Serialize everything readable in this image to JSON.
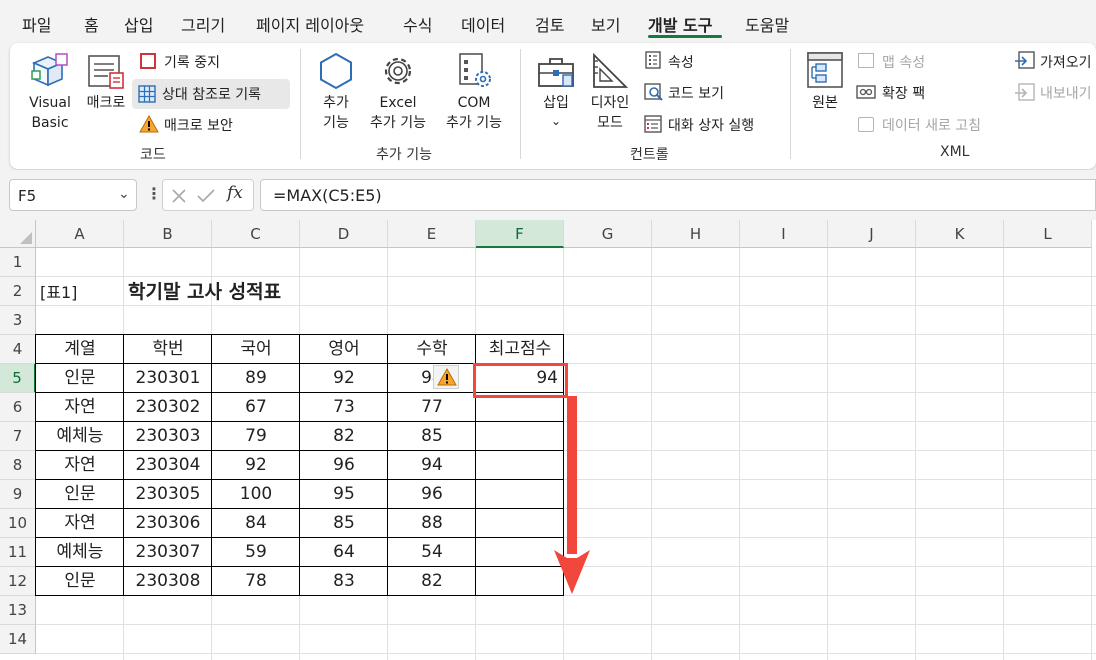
{
  "menu": {
    "items": [
      "파일",
      "홈",
      "삽입",
      "그리기",
      "페이지 레이아웃",
      "수식",
      "데이터",
      "검토",
      "보기",
      "개발 도구",
      "도움말"
    ]
  },
  "ribbon": {
    "code": {
      "visual_basic_1": "Visual",
      "visual_basic_2": "Basic",
      "macro": "매크로",
      "record_stop": "기록 중지",
      "relative_ref": "상대 참조로 기록",
      "macro_security": "매크로 보안",
      "label": "코드"
    },
    "addins": {
      "addins_1": "추가",
      "addins_2": "기능",
      "excel_1": "Excel",
      "excel_2": "추가 기능",
      "com_1": "COM",
      "com_2": "추가 기능",
      "label": "추가 기능"
    },
    "controls": {
      "insert": "삽입",
      "design_1": "디자인",
      "design_2": "모드",
      "properties": "속성",
      "view_code": "코드 보기",
      "run_dialog": "대화 상자 실행",
      "label": "컨트롤"
    },
    "xml": {
      "source": "원본",
      "map_properties": "맵 속성",
      "expansion_packs": "확장 팩",
      "refresh_data": "데이터 새로 고침",
      "import": "가져오기",
      "export": "내보내기",
      "label": "XML"
    }
  },
  "formula_bar": {
    "name_box": "F5",
    "formula": "=MAX(C5:E5)"
  },
  "sheet": {
    "columns": [
      "A",
      "B",
      "C",
      "D",
      "E",
      "F",
      "G",
      "H",
      "I",
      "J",
      "K",
      "L"
    ],
    "rows": [
      "1",
      "2",
      "3",
      "4",
      "5",
      "6",
      "7",
      "8",
      "9",
      "10",
      "11",
      "12",
      "13",
      "14"
    ],
    "label_a2": "[표1]",
    "title": "학기말 고사 성적표",
    "headers": [
      "계열",
      "학번",
      "국어",
      "영어",
      "수학",
      "최고점수"
    ],
    "data": [
      [
        "인문",
        "230301",
        "89",
        "92",
        "94",
        "94"
      ],
      [
        "자연",
        "230302",
        "67",
        "73",
        "77",
        ""
      ],
      [
        "예체능",
        "230303",
        "79",
        "82",
        "85",
        ""
      ],
      [
        "자연",
        "230304",
        "92",
        "96",
        "94",
        ""
      ],
      [
        "인문",
        "230305",
        "100",
        "95",
        "96",
        ""
      ],
      [
        "자연",
        "230306",
        "84",
        "85",
        "88",
        ""
      ],
      [
        "예체능",
        "230307",
        "59",
        "64",
        "54",
        ""
      ],
      [
        "인문",
        "230308",
        "78",
        "83",
        "82",
        ""
      ]
    ],
    "selected_col": "F",
    "selected_row": "5"
  },
  "colors": {
    "accent": "#107c41",
    "highlight": "#f2473d"
  }
}
